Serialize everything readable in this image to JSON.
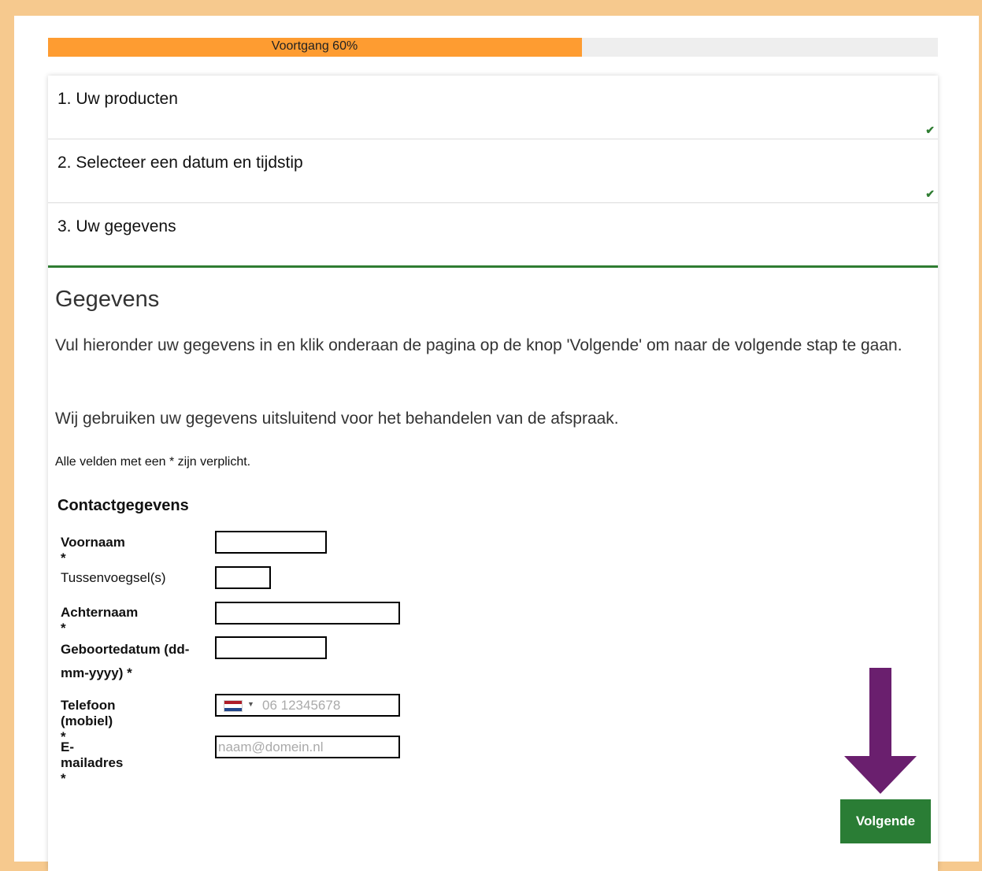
{
  "progress": {
    "label": "Voortgang 60%",
    "percent": 60
  },
  "steps": [
    {
      "title": "1. Uw producten",
      "completed": true
    },
    {
      "title": "2. Selecteer een datum en tijdstip",
      "completed": true
    },
    {
      "title": "3. Uw gegevens",
      "completed": false
    }
  ],
  "check_glyph": "✔",
  "form": {
    "heading": "Gegevens",
    "intro": "Vul hieronder uw gegevens in en klik onderaan de pagina op de knop 'Volgende' om naar de volgende stap te gaan.",
    "privacy": "Wij gebruiken uw gegevens uitsluitend voor het behandelen van de afspraak.",
    "required_note": "Alle velden met een * zijn verplicht.",
    "section_title": "Contactgegevens",
    "fields": {
      "first_name": {
        "label": "Voornaam  *",
        "value": ""
      },
      "infix": {
        "label": "Tussenvoegsel(s)",
        "value": ""
      },
      "last_name": {
        "label": "Achternaam  *",
        "value": ""
      },
      "birth_date": {
        "label": "Geboortedatum (dd-mm-yyyy)  *",
        "value": ""
      },
      "phone": {
        "label": "Telefoon (mobiel)  *",
        "placeholder": "06 12345678",
        "country_flag": "netherlands-flag-icon",
        "value": ""
      },
      "email": {
        "label": "E-mailadres  *",
        "placeholder": "naam@domein.nl",
        "value": ""
      }
    }
  },
  "next_button": {
    "label": "Volgende"
  },
  "colors": {
    "frame": "#f6c98e",
    "progress_fill": "#fe9c31",
    "accent_green": "#2a7d35",
    "arrow_purple": "#6a1f6e"
  }
}
